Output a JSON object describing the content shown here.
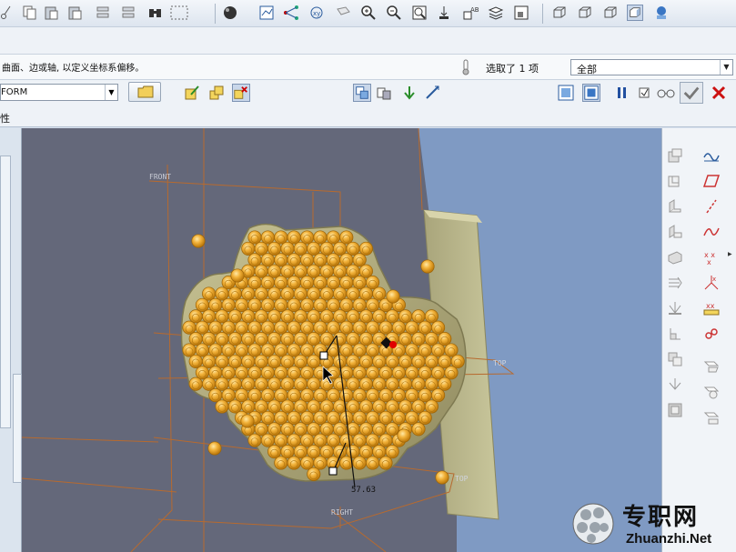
{
  "toolbar": {
    "icons": [
      "cut-icon",
      "copy-icon",
      "paste-icon",
      "paste-special-icon",
      "regenerate-icon",
      "regen-manager-icon",
      "find-icon",
      "select-box-icon",
      "shade-sphere-icon",
      "saved-views-icon",
      "datum-display-icon",
      "csys-icon",
      "spin-center-icon",
      "repaint-icon",
      "zoom-in-icon",
      "zoom-out-icon",
      "refit-icon",
      "orient-icon",
      "annotation-display-icon",
      "layers-icon",
      "view-manager-icon",
      "wireframe-icon",
      "hidden-line-icon",
      "no-hidden-icon",
      "shading-icon",
      "model-tree-icon"
    ]
  },
  "message": {
    "text": "曲面、边或轴, 以定义坐标系偏移。",
    "selection_count": "选取了 1 项",
    "filter_value": "全部"
  },
  "dashboard": {
    "form_value": "FORM",
    "tab_label": "性",
    "canvas_labels": {
      "front": "FRONT",
      "top1": "TOP",
      "top2": "TOP",
      "right": "RIGHT",
      "dimension": "57.63"
    }
  },
  "watermark": {
    "cn": "专职网",
    "en": "Zhuanzhi.Net"
  },
  "colors": {
    "background": "#64687a",
    "plate": "#a9a77a",
    "dimple": "#e3a62a",
    "datum": "#b76a2f",
    "selection": "#e00000"
  }
}
